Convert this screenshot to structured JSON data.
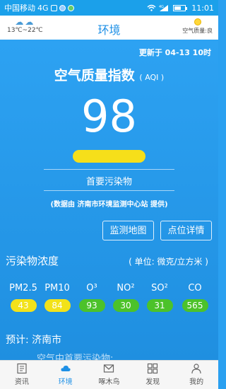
{
  "status_bar": {
    "carrier": "中国移动",
    "network": "4G",
    "signal_label": "4G",
    "time": "11:01"
  },
  "header": {
    "title": "环境",
    "temperature": "13℃~22℃",
    "air_quality": "空气质量:良"
  },
  "aqi": {
    "updated": "更新于 04-13 10时",
    "title": "空气质量指数",
    "unit": "( AQI )",
    "value": "98",
    "bar_color": "#f6df1a",
    "primary_pollutant_label": "首要污染物",
    "source": "(数据由 济南市环境监测中心站 提供)"
  },
  "buttons": {
    "map": "监测地图",
    "detail": "点位详情"
  },
  "concentration": {
    "title": "污染物浓度",
    "unit": "( 单位: 微克/立方米 )",
    "items": [
      {
        "name": "PM2.5",
        "value": "43",
        "color": "#f2e21a"
      },
      {
        "name": "PM10",
        "value": "84",
        "color": "#f2e21a"
      },
      {
        "name": "O³",
        "value": "93",
        "color": "#4cc22a"
      },
      {
        "name": "NO²",
        "value": "30",
        "color": "#4cc22a"
      },
      {
        "name": "SO²",
        "value": "31",
        "color": "#4cc22a"
      },
      {
        "name": "CO",
        "value": "565",
        "color": "#4cc22a"
      }
    ]
  },
  "forecast": {
    "label": "预计:  济南市",
    "sub": "空气中首要污染物:"
  },
  "tabs": [
    {
      "label": "资讯",
      "icon": "news-icon"
    },
    {
      "label": "环境",
      "icon": "cloud-icon"
    },
    {
      "label": "啄木鸟",
      "icon": "mail-icon"
    },
    {
      "label": "发现",
      "icon": "grid-icon"
    },
    {
      "label": "我的",
      "icon": "person-icon"
    }
  ],
  "colors": {
    "accent": "#1e90e6",
    "background": "#2aa0f0"
  }
}
